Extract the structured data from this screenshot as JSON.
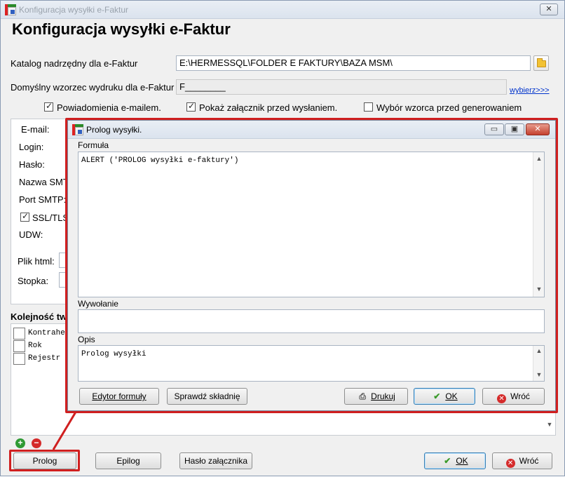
{
  "window": {
    "title": "Konfiguracja wysyłki e-Faktur",
    "heading": "Konfiguracja wysyłki e-Faktur",
    "close_symbol": "✕"
  },
  "form": {
    "catalog_label": "Katalog nadrzędny dla e-Faktur",
    "catalog_value": "E:\\HERMESSQL\\FOLDER E FAKTURY\\BAZA MSM\\",
    "template_label": "Domyślny wzorzec wydruku dla e-Faktur",
    "template_value": "F________",
    "choose_link": "wybierz>>>",
    "checkboxes": [
      {
        "label": "Powiadomienia e-mailem.",
        "checked": true
      },
      {
        "label": "Pokaż załącznik przed wysłaniem.",
        "checked": true
      },
      {
        "label": "Wybór wzorca przed generowaniem",
        "checked": false
      }
    ]
  },
  "mail_panel": {
    "email_label": "E-mail:",
    "login_label": "Login:",
    "password_label": "Hasło:",
    "smtp_name_label": "Nazwa SMT",
    "smtp_port_label": "Port SMTP:",
    "ssl_label": "SSL/TLS",
    "ssl_checked": true,
    "udw_label": "UDW:",
    "html_file_label": "Plik html:",
    "footer_label": "Stopka:"
  },
  "order_panel": {
    "heading": "Kolejność tw",
    "items": [
      "Kontrahe",
      "Rok",
      "Rejestr"
    ]
  },
  "main_buttons": {
    "prolog": "Prolog",
    "epilog": "Epilog",
    "attachment_password": "Hasło załącznika",
    "ok": "OK",
    "back": "Wróć"
  },
  "dialog": {
    "title": "Prolog wysyłki.",
    "formula_label": "Formuła",
    "formula_text": "ALERT ('PROLOG wysyłki e-faktury')",
    "call_label": "Wywołanie",
    "call_value": "",
    "desc_label": "Opis",
    "desc_text": "Prolog wysyłki",
    "buttons": {
      "formula_editor": "Edytor formuły",
      "check_syntax": "Sprawdź składnię",
      "print": "Drukuj",
      "ok": "OK",
      "back": "Wróć"
    },
    "min_symbol": "▭",
    "max_symbol": "▣",
    "close_symbol": "✕"
  },
  "colors": {
    "highlight_red": "#d01f1f",
    "link_blue": "#0033cc"
  }
}
